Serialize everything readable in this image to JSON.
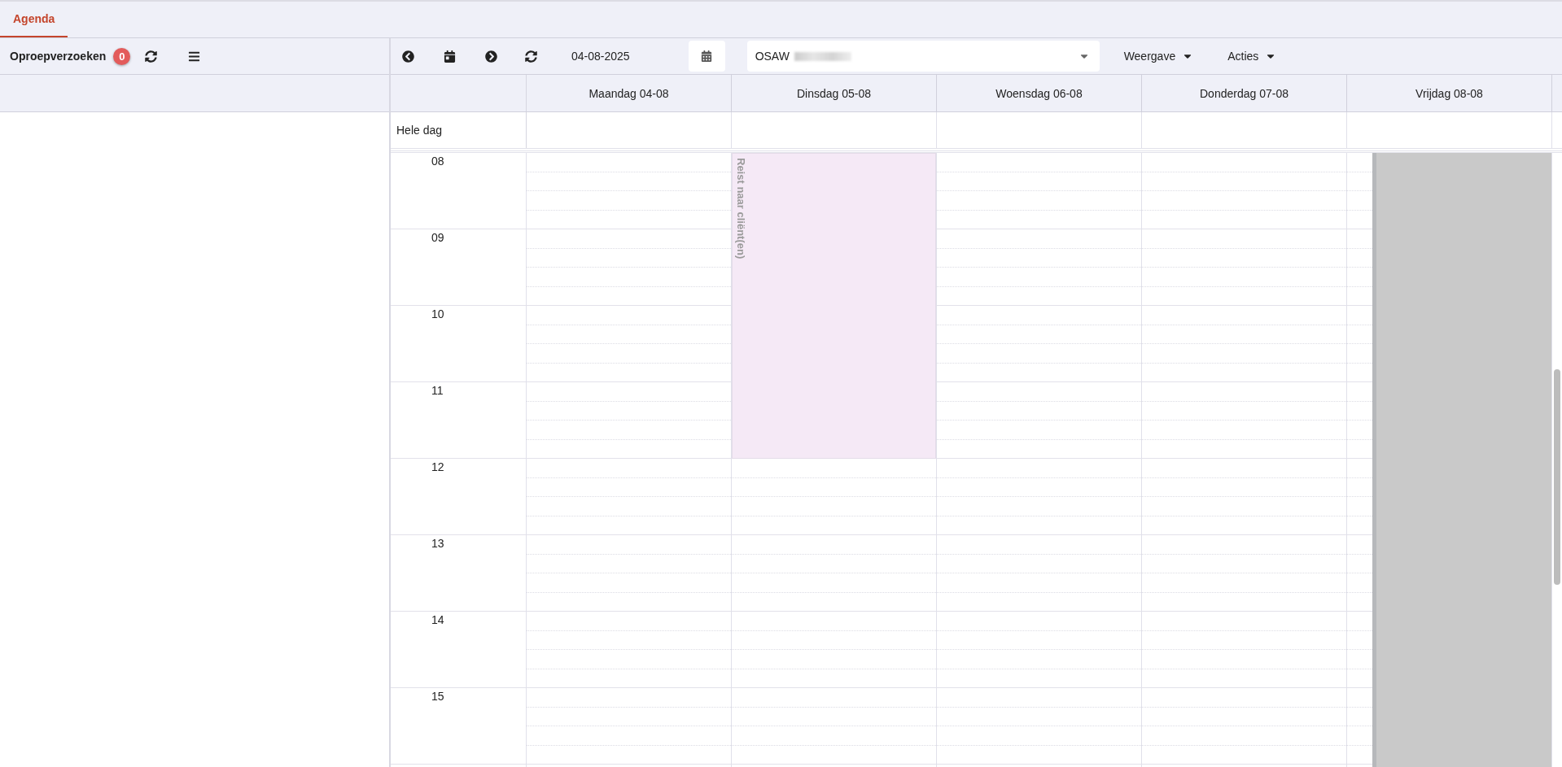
{
  "tabs": [
    {
      "label": "Agenda",
      "selected": true
    }
  ],
  "left_toolbar": {
    "title": "Oproepverzoeken",
    "badge": "0"
  },
  "toolbar": {
    "date": "04-08-2025",
    "select": {
      "value": "OSAW",
      "redacted": true
    },
    "menus": [
      "Weergave",
      "Acties"
    ]
  },
  "calendar": {
    "all_day_label": "Hele dag",
    "hours": [
      "08",
      "09",
      "10",
      "11",
      "12",
      "13",
      "14",
      "15"
    ],
    "days": [
      {
        "label": "Maandag 04-08"
      },
      {
        "label": "Dinsdag 05-08",
        "appointment_label": "Reist naar cliënt(en)",
        "cells": [
          {
            "kind": "appointment"
          },
          {
            "kind": "appointment"
          },
          {
            "kind": "appointment"
          },
          {
            "kind": "appointment"
          },
          {
            "kind": "free"
          },
          {
            "kind": "free"
          },
          {
            "kind": "free"
          },
          {
            "kind": "free"
          }
        ]
      },
      {
        "label": "Woensdag 06-08"
      },
      {
        "label": "Donderdag 07-08"
      },
      {
        "label": "Vrijdag 08-08",
        "cells": [
          {
            "kind": "unavailable"
          },
          {
            "kind": "unavailable"
          },
          {
            "kind": "unavailable"
          },
          {
            "kind": "unavailable"
          },
          {
            "kind": "unavailable"
          },
          {
            "kind": "unavailable"
          },
          {
            "kind": "unavailable"
          },
          {
            "kind": "unavailable"
          }
        ]
      }
    ]
  }
}
